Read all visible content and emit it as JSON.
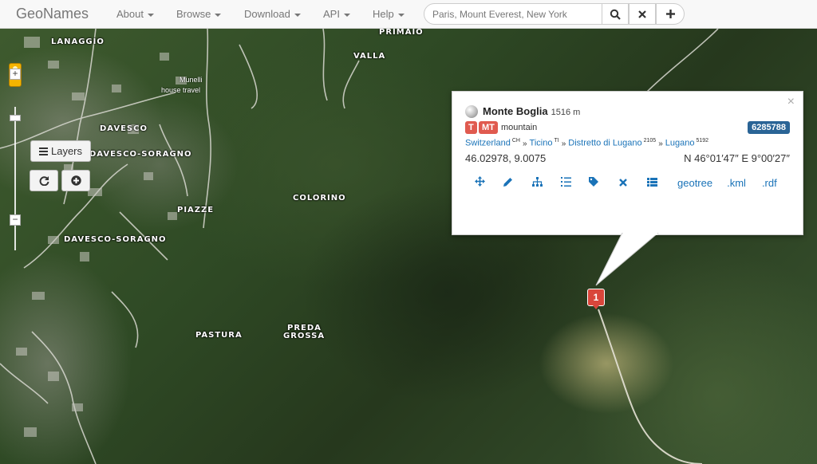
{
  "navbar": {
    "brand": "GeoNames",
    "menus": [
      {
        "label": "About"
      },
      {
        "label": "Browse"
      },
      {
        "label": "Download"
      },
      {
        "label": "API"
      },
      {
        "label": "Help"
      }
    ],
    "search_placeholder": "Paris, Mount Everest, New York",
    "search_icon": "search-icon",
    "clear_icon": "close-icon",
    "add_icon": "plus-icon"
  },
  "map_controls": {
    "layers_label": "Layers",
    "zoom_in": "+",
    "zoom_out": "−"
  },
  "map_labels": {
    "lanaggio": "LANAGGIO",
    "primaio": "PRIMAIO",
    "valla": "VALLA",
    "davesco": "DAVESCO",
    "davesco_soragno_1": "DAVESCO-SORAGNO",
    "davesco_soragno_2": "DAVESCO-SORAGNO",
    "colorino": "COLORINO",
    "piazze": "PIAZZE",
    "pastura": "PASTURA",
    "preda": "PREDA",
    "grossa": "GROSSA",
    "munelli": "Munelli",
    "house_travel": "house travel"
  },
  "popup": {
    "name": "Monte Boglia",
    "elevation": "1516 m",
    "feature_class": "T",
    "feature_code": "MT",
    "feature_text": "mountain",
    "geoname_id": "6285788",
    "hierarchy": [
      {
        "name": "Switzerland",
        "code": "CH"
      },
      {
        "name": "Ticino",
        "code": "TI"
      },
      {
        "name": "Distretto di Lugano",
        "code": "2105"
      },
      {
        "name": "Lugano",
        "code": "5192"
      }
    ],
    "separator": "»",
    "coordinates": "46.02978, 9.0075",
    "dms": "N 46°01′47″ E 9°00′27″",
    "close": "×",
    "links": {
      "geotree": "geotree",
      "kml": ".kml",
      "rdf": ".rdf"
    }
  },
  "marker": {
    "label": "1"
  },
  "colors": {
    "marker": "#d9463b",
    "link": "#1a73b8",
    "id_badge": "#2a6496"
  }
}
